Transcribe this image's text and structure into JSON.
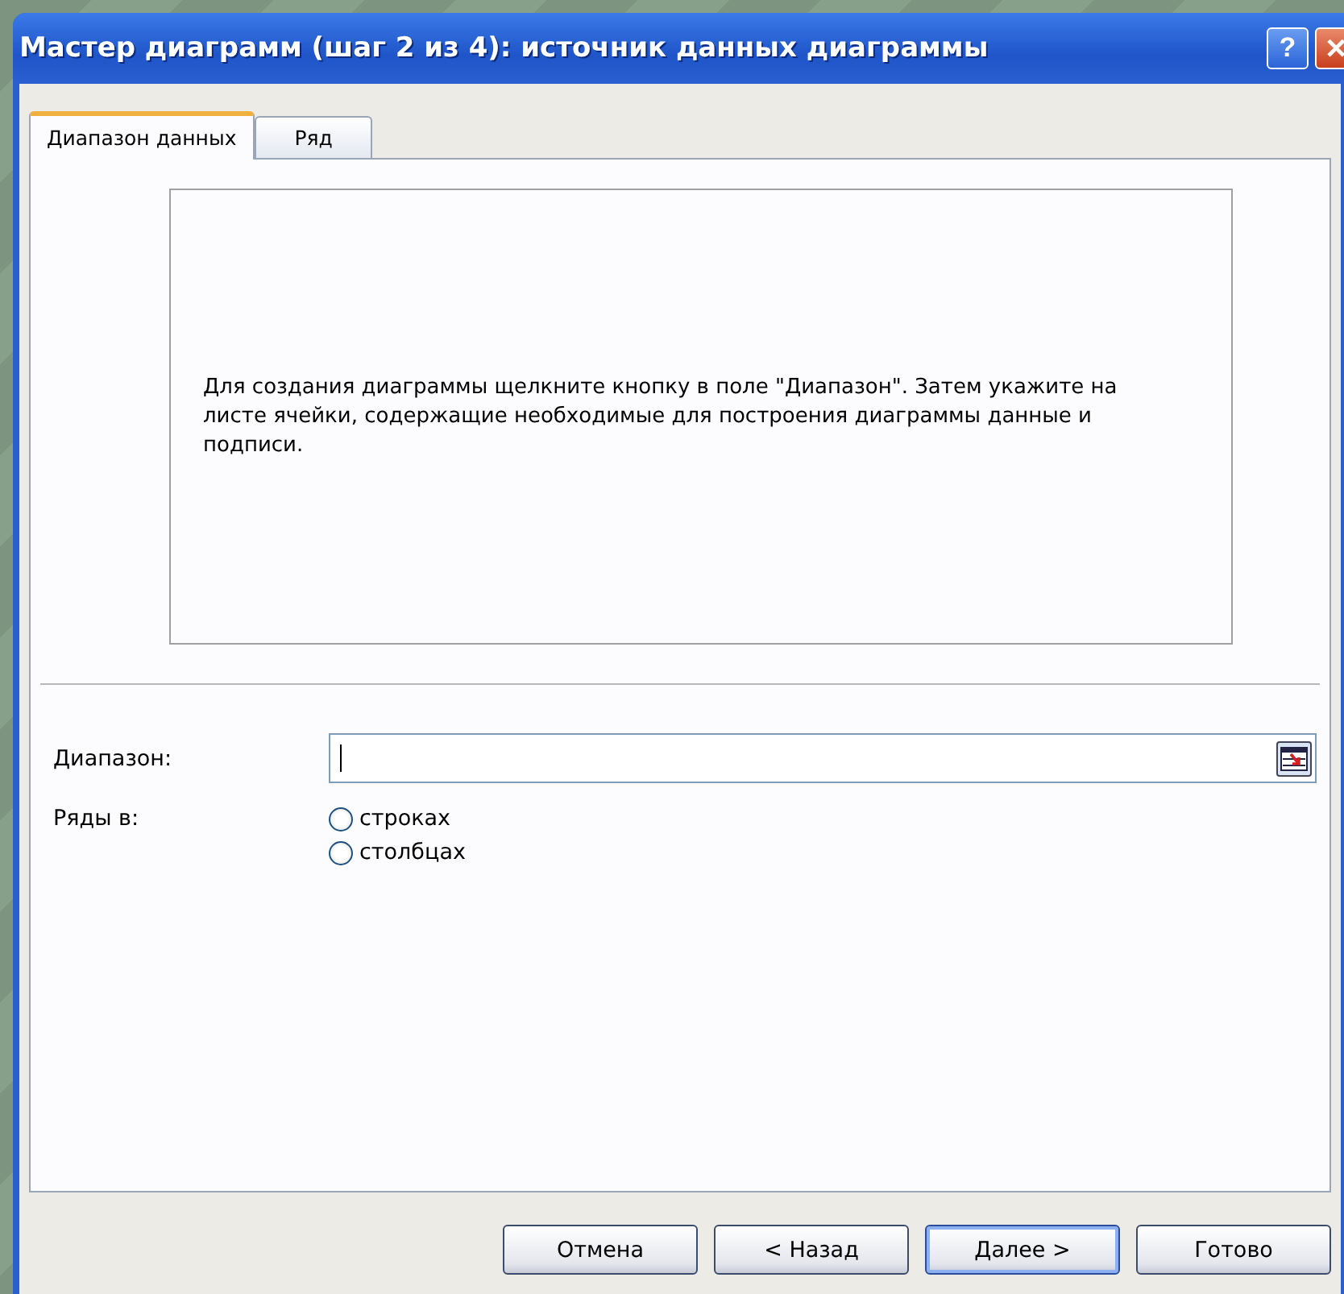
{
  "window": {
    "title": "Мастер диаграмм (шаг 2 из 4): источник данных диаграммы",
    "buttons": [
      {
        "kind": "help",
        "label": "?"
      },
      {
        "kind": "close",
        "label": "✕"
      }
    ]
  },
  "tabs": [
    {
      "label": "Диапазон данных",
      "selected": true
    },
    {
      "label": "Ряд",
      "selected": false
    }
  ],
  "preview": {
    "message": "Для создания диаграммы щелкните кнопку в поле \"Диапазон\". Затем укажите на листе ячейки, содержащие необходимые для построения диаграммы данные и подписи."
  },
  "range": {
    "label": "Диапазон:"
  },
  "series_in": {
    "label": "Ряды в:",
    "options": [
      {
        "label": "строках",
        "selected": false
      },
      {
        "label": "столбцах",
        "selected": false
      }
    ]
  },
  "buttons": [
    {
      "label": "Отмена",
      "default": false
    },
    {
      "label": "< Назад",
      "default": false
    },
    {
      "label": "Далее >",
      "default": true
    },
    {
      "label": "Готово",
      "default": false
    }
  ]
}
